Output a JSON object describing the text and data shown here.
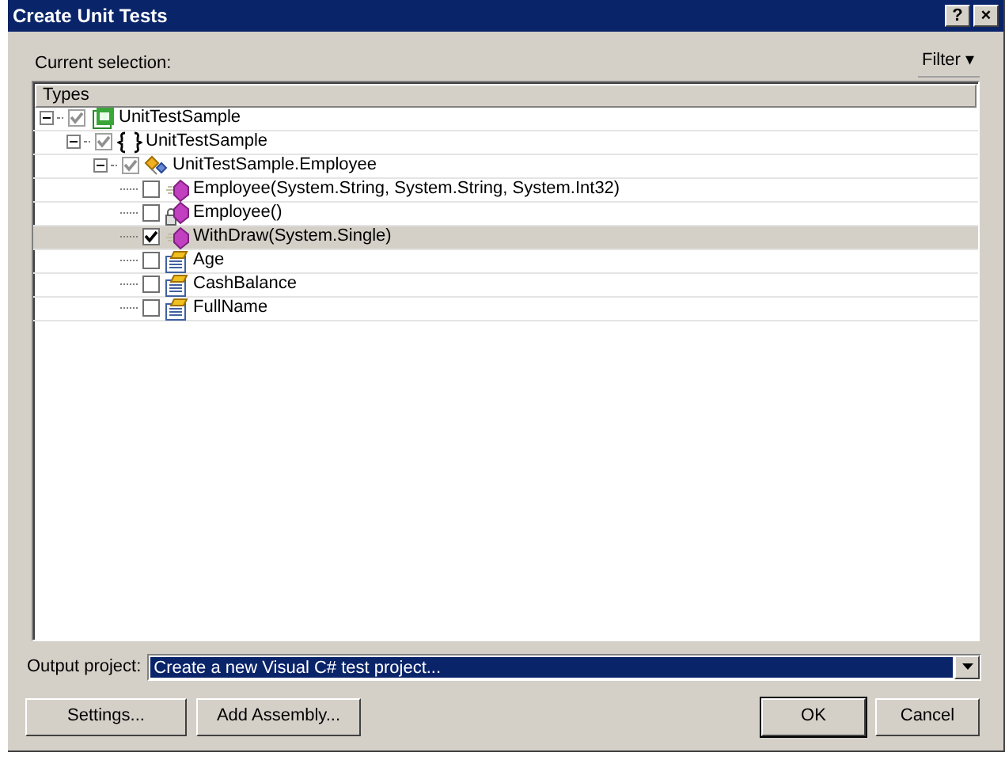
{
  "window": {
    "title": "Create Unit Tests",
    "help_button": "?",
    "close_button": "×"
  },
  "current_selection_label": "Current selection:",
  "filter": {
    "label": "Filter",
    "caret": "▾"
  },
  "tree": {
    "column": "Types",
    "items": [
      {
        "label": "UnitTestSample",
        "kind": "project",
        "checked": true,
        "mixed": true,
        "expanded": true,
        "selected": false,
        "children": [
          {
            "label": "UnitTestSample",
            "kind": "namespace",
            "checked": true,
            "mixed": true,
            "expanded": true,
            "selected": false,
            "children": [
              {
                "label": "UnitTestSample.Employee",
                "kind": "class",
                "checked": true,
                "mixed": true,
                "expanded": true,
                "selected": false,
                "children": [
                  {
                    "label": "Employee(System.String, System.String, System.Int32)",
                    "kind": "method",
                    "checked": false,
                    "selected": false
                  },
                  {
                    "label": "Employee()",
                    "kind": "private-method",
                    "checked": false,
                    "selected": false
                  },
                  {
                    "label": "WithDraw(System.Single)",
                    "kind": "method",
                    "checked": true,
                    "selected": true
                  },
                  {
                    "label": "Age",
                    "kind": "property",
                    "checked": false,
                    "selected": false
                  },
                  {
                    "label": "CashBalance",
                    "kind": "property",
                    "checked": false,
                    "selected": false
                  },
                  {
                    "label": "FullName",
                    "kind": "property",
                    "checked": false,
                    "selected": false
                  }
                ]
              }
            ]
          }
        ]
      }
    ]
  },
  "output_project": {
    "label": "Output project:",
    "value": "Create a new Visual C# test project..."
  },
  "buttons": [
    {
      "label": "Settings...",
      "default": false
    },
    {
      "label": "Add Assembly...",
      "default": false
    },
    {
      "label": "OK",
      "default": true
    },
    {
      "label": "Cancel",
      "default": false
    }
  ]
}
